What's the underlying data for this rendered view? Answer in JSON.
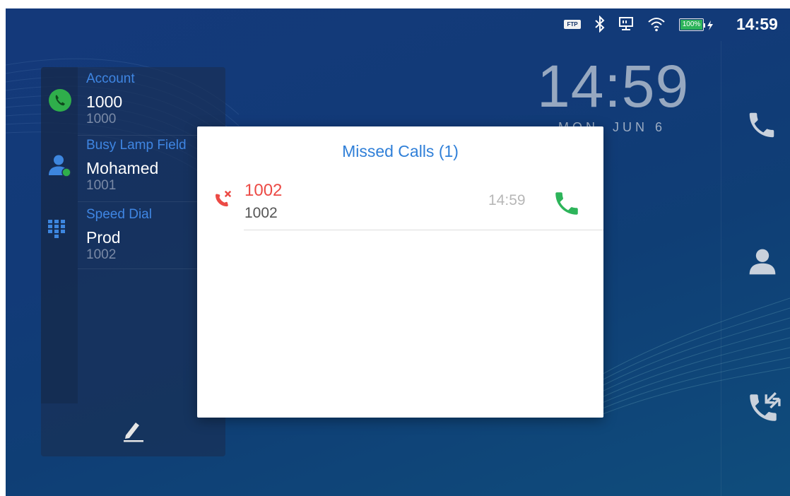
{
  "status_bar": {
    "ftp_label": "FTP",
    "battery_label": "100%",
    "battery_level": 1.0,
    "time": "14:59",
    "icons": [
      "ftp-icon",
      "bluetooth-icon",
      "network-icon",
      "wifi-icon",
      "battery-icon",
      "charging-icon"
    ]
  },
  "clock": {
    "time": "14:59",
    "date": "MON, JUN 6"
  },
  "left_panel": {
    "sections": [
      {
        "category": "Account",
        "name": "1000",
        "number": "1000",
        "icon": "phone-icon"
      },
      {
        "category": "Busy Lamp Field",
        "name": "Mohamed",
        "number": "1001",
        "icon": "contact-icon"
      },
      {
        "category": "Speed Dial",
        "name": "Prod",
        "number": "1002",
        "icon": "dialpad-icon"
      }
    ],
    "edit_icon": "pencil-icon"
  },
  "right_bar": {
    "icons": [
      "phone-icon",
      "contacts-icon",
      "call-history-icon"
    ]
  },
  "dialog": {
    "title": "Missed Calls (1)",
    "calls": [
      {
        "name": "1002",
        "number": "1002",
        "time": "14:59"
      }
    ]
  },
  "colors": {
    "accent": "#2f7fd8",
    "missed": "#ec4a45",
    "call_green": "#2db45a",
    "category_blue": "#3f86e3"
  }
}
